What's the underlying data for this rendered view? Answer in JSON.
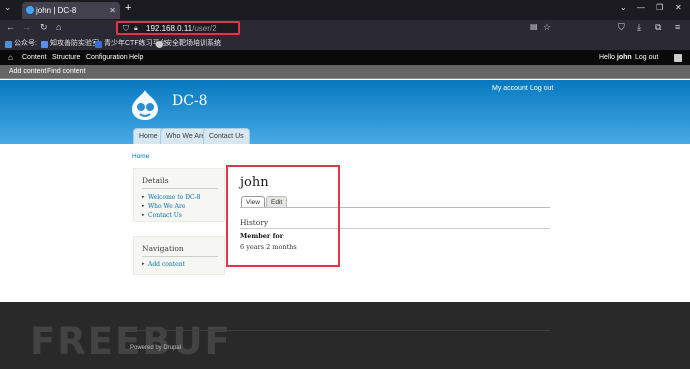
{
  "browser": {
    "tab_title": "john | DC-8",
    "new_tab": "+",
    "url_host": "192.168.0.11",
    "url_path": "/user/2",
    "window_controls": [
      "minimize-icon",
      "restore-icon",
      "close-icon"
    ],
    "bookmarks": [
      {
        "label": "公众号:",
        "color": "#4a90d9"
      },
      {
        "label": "知攻善防实验室",
        "color": "#5b8def"
      },
      {
        "label": "青少年CTF练习平台",
        "color": "#3b6fd4"
      },
      {
        "label": "安全靶场培训系统",
        "color": "#cccccc"
      }
    ]
  },
  "admin_toolbar": {
    "home_icon": "home-icon",
    "items": [
      "Content",
      "Structure",
      "Configuration",
      "Help"
    ],
    "greeting_prefix": "Hello",
    "user": "john",
    "logout": "Log out"
  },
  "shortcuts": [
    "Add content",
    "Find content"
  ],
  "site": {
    "name": "DC-8",
    "secondary_menu": [
      "My account",
      "Log out"
    ],
    "main_menu": [
      "Home",
      "Who We Are",
      "Contact Us"
    ]
  },
  "breadcrumb": "Home",
  "sidebar": {
    "details": {
      "title": "Details",
      "links": [
        "Welcome to DC-8",
        "Who We Are",
        "Contact Us"
      ]
    },
    "navigation": {
      "title": "Navigation",
      "links": [
        "Add content"
      ]
    }
  },
  "content": {
    "title": "john",
    "tabs": [
      "View",
      "Edit"
    ],
    "history_heading": "History",
    "member_for_label": "Member for",
    "member_for_value": "6 years 2 months"
  },
  "footer": {
    "powered": "Powered by Drupal",
    "watermark": "FREEBUF"
  },
  "colors": {
    "header_top": "#0779bf",
    "header_bottom": "#48a9e4",
    "link": "#0071b3",
    "highlight_box": "#e0334c",
    "footer_bg": "#292929"
  }
}
